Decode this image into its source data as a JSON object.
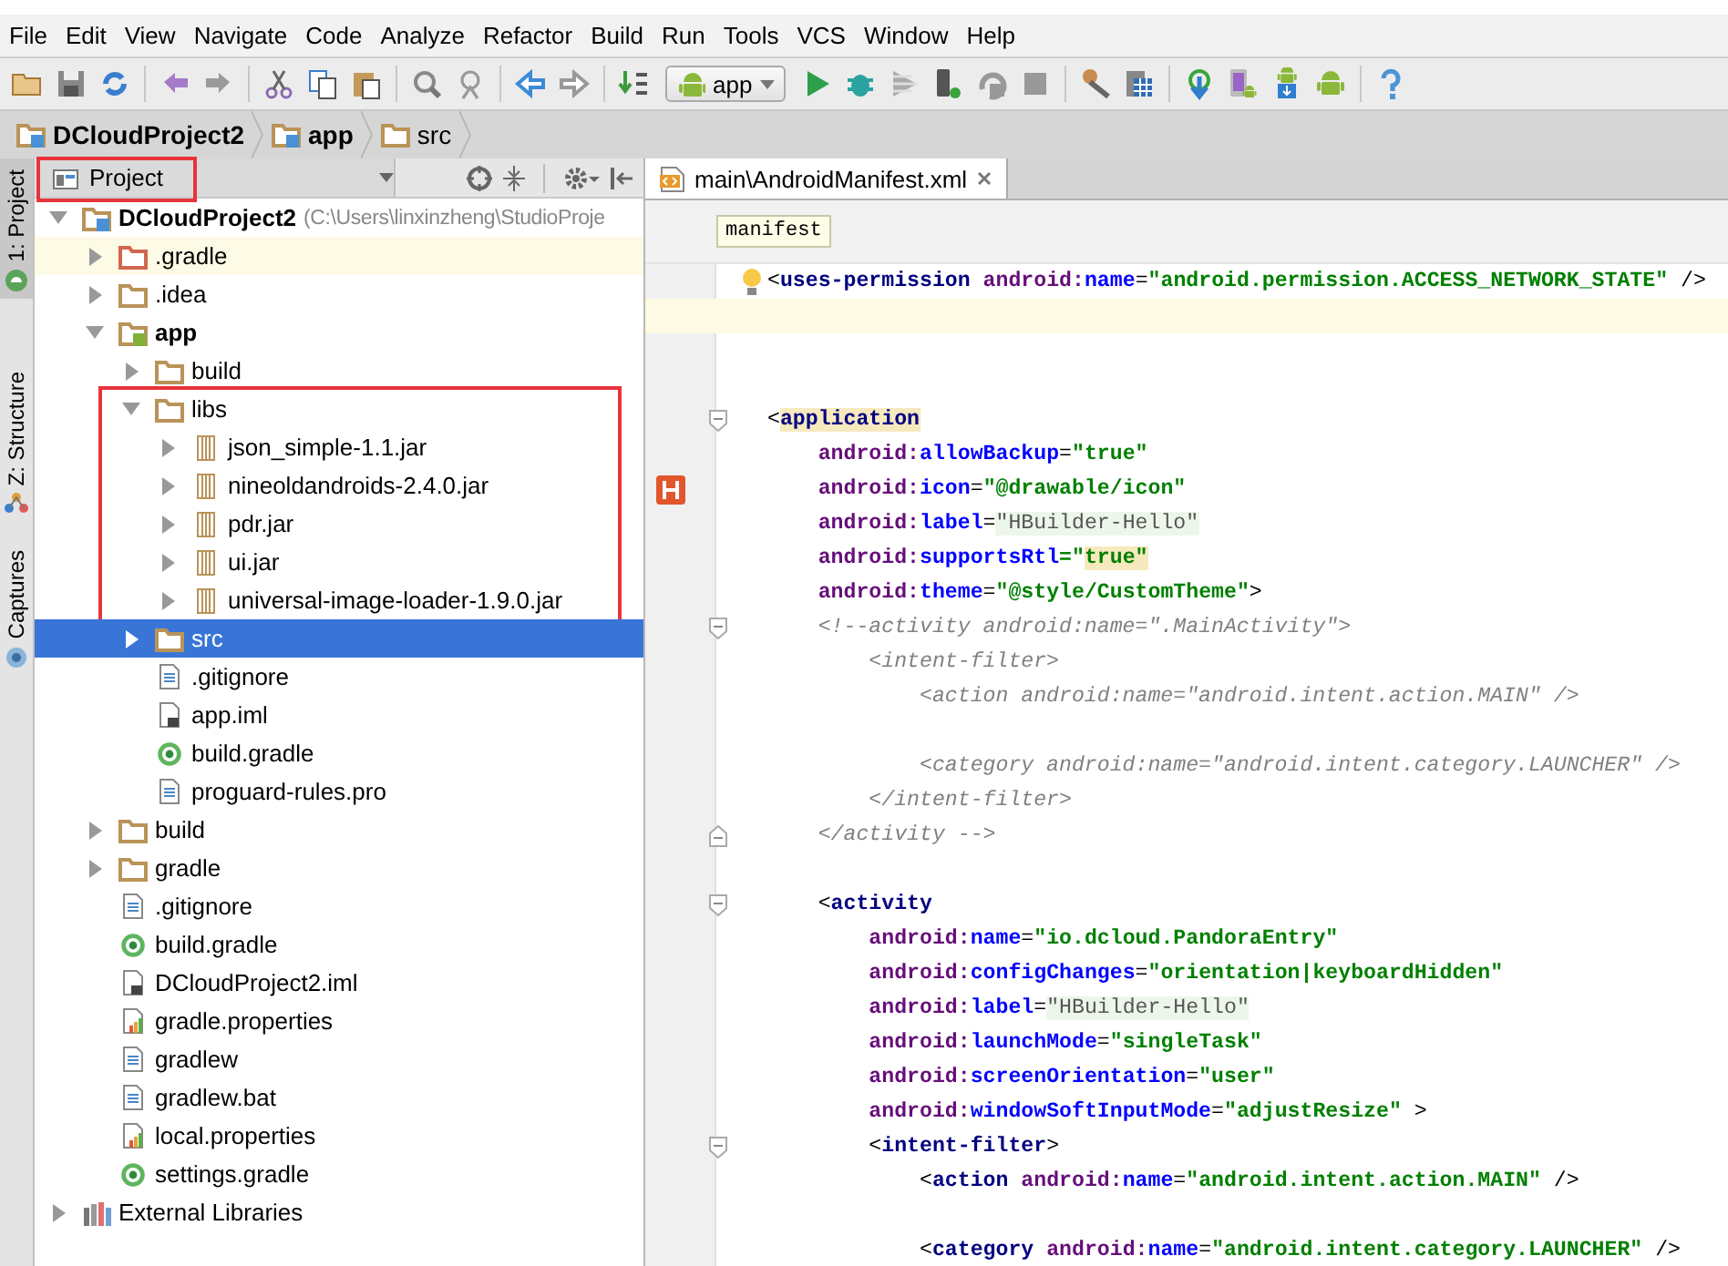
{
  "menu": [
    "File",
    "Edit",
    "View",
    "Navigate",
    "Code",
    "Analyze",
    "Refactor",
    "Build",
    "Run",
    "Tools",
    "VCS",
    "Window",
    "Help"
  ],
  "toolbar": {
    "run_config": "app"
  },
  "breadcrumb": [
    {
      "label": "DCloudProject2",
      "kind": "module"
    },
    {
      "label": "app",
      "kind": "module"
    },
    {
      "label": "src",
      "kind": "folder"
    }
  ],
  "side_tabs": [
    {
      "label": "1: Project",
      "kind": "project",
      "selected": true
    },
    {
      "label": "Z: Structure",
      "kind": "structure",
      "selected": false
    },
    {
      "label": "Captures",
      "kind": "captures",
      "selected": false
    }
  ],
  "project_panel": {
    "view": "Project",
    "outlined": true,
    "tree": [
      {
        "label": "DCloudProject2",
        "note": "(C:\\Users\\linxinzheng\\StudioProje",
        "kind": "project",
        "expanded": true,
        "selected": false,
        "children": [
          {
            "label": ".gradle",
            "kind": "excluded-folder",
            "expanded": false,
            "selected": false
          },
          {
            "label": ".idea",
            "kind": "folder",
            "expanded": false,
            "selected": false
          },
          {
            "label": "app",
            "kind": "app-module",
            "expanded": true,
            "selected": false,
            "children": [
              {
                "label": "build",
                "kind": "folder",
                "expanded": false,
                "selected": false
              },
              {
                "label": "libs",
                "kind": "folder",
                "expanded": true,
                "selected": false,
                "outlined": true,
                "children": [
                  {
                    "label": "json_simple-1.1.jar",
                    "kind": "jar",
                    "expanded": false,
                    "selected": false
                  },
                  {
                    "label": "nineoldandroids-2.4.0.jar",
                    "kind": "jar",
                    "expanded": false,
                    "selected": false
                  },
                  {
                    "label": "pdr.jar",
                    "kind": "jar",
                    "expanded": false,
                    "selected": false
                  },
                  {
                    "label": "ui.jar",
                    "kind": "jar",
                    "expanded": false,
                    "selected": false
                  },
                  {
                    "label": "universal-image-loader-1.9.0.jar",
                    "kind": "jar",
                    "expanded": false,
                    "selected": false
                  }
                ]
              },
              {
                "label": "src",
                "kind": "folder",
                "expanded": false,
                "selected": true
              },
              {
                "label": ".gitignore",
                "kind": "text",
                "selected": false
              },
              {
                "label": "app.iml",
                "kind": "iml",
                "selected": false
              },
              {
                "label": "build.gradle",
                "kind": "gradle",
                "selected": false
              },
              {
                "label": "proguard-rules.pro",
                "kind": "text",
                "selected": false
              }
            ]
          },
          {
            "label": "build",
            "kind": "folder",
            "expanded": false,
            "selected": false
          },
          {
            "label": "gradle",
            "kind": "folder",
            "expanded": false,
            "selected": false
          },
          {
            "label": ".gitignore",
            "kind": "text",
            "selected": false
          },
          {
            "label": "build.gradle",
            "kind": "gradle",
            "selected": false
          },
          {
            "label": "DCloudProject2.iml",
            "kind": "iml",
            "selected": false
          },
          {
            "label": "gradle.properties",
            "kind": "properties",
            "selected": false
          },
          {
            "label": "gradlew",
            "kind": "text",
            "selected": false
          },
          {
            "label": "gradlew.bat",
            "kind": "text",
            "selected": false
          },
          {
            "label": "local.properties",
            "kind": "properties",
            "selected": false
          },
          {
            "label": "settings.gradle",
            "kind": "gradle",
            "selected": false
          }
        ]
      },
      {
        "label": "External Libraries",
        "kind": "libraries",
        "expanded": false,
        "selected": false
      }
    ]
  },
  "editor": {
    "tabs": [
      {
        "label": "main\\AndroidManifest.xml",
        "selected": true
      }
    ],
    "tag_path": [
      "manifest"
    ],
    "lines": [
      {
        "bulb": true,
        "tokens": [
          {
            "text": "<",
            "kind": "punct"
          },
          {
            "text": "uses-permission",
            "kind": "tag"
          },
          {
            "text": " android:",
            "kind": "ns"
          },
          {
            "text": "name",
            "kind": "attr"
          },
          {
            "text": "=",
            "kind": "punct"
          },
          {
            "text": "\"android.permission.ACCESS_NETWORK_STATE\"",
            "kind": "value"
          },
          {
            "text": " />",
            "kind": "punct"
          }
        ]
      },
      {
        "current": true,
        "space_after": true
      },
      {
        "space_before": true,
        "fold_start": true,
        "tokens": [
          {
            "text": "<",
            "kind": "punct"
          },
          {
            "text": "application",
            "kind": "tag",
            "matched": true
          }
        ]
      },
      {
        "tokens": [
          {
            "text": "    android:",
            "kind": "ns"
          },
          {
            "text": "allowBackup",
            "kind": "attr"
          },
          {
            "text": "=",
            "kind": "punct"
          },
          {
            "text": "\"true\"",
            "kind": "value"
          }
        ]
      },
      {
        "logo": true,
        "tokens": [
          {
            "text": "    android:",
            "kind": "ns"
          },
          {
            "text": "icon",
            "kind": "attr"
          },
          {
            "text": "=",
            "kind": "punct"
          },
          {
            "text": "\"@drawable/icon\"",
            "kind": "value"
          }
        ]
      },
      {
        "tokens": [
          {
            "text": "    android:",
            "kind": "ns"
          },
          {
            "text": "label",
            "kind": "attr"
          },
          {
            "text": "=",
            "kind": "punct"
          },
          {
            "text": "\"HBuilder-Hello\"",
            "kind": "folded",
            "injected": true
          }
        ]
      },
      {
        "tokens": [
          {
            "text": "    android:",
            "kind": "ns"
          },
          {
            "text": "supportsRtl",
            "kind": "attr"
          },
          {
            "text": "=\"",
            "kind": "value"
          },
          {
            "text": "true\"",
            "kind": "value",
            "matched": true
          }
        ]
      },
      {
        "tokens": [
          {
            "text": "    android:",
            "kind": "ns"
          },
          {
            "text": "theme",
            "kind": "attr"
          },
          {
            "text": "=",
            "kind": "punct"
          },
          {
            "text": "\"@style/CustomTheme\"",
            "kind": "value"
          },
          {
            "text": ">",
            "kind": "punct"
          }
        ]
      },
      {
        "fold_start": true,
        "tokens": [
          {
            "text": "    <!--activity android:name=\".MainActivity\">",
            "kind": "comment"
          }
        ]
      },
      {
        "tokens": [
          {
            "text": "        <intent-filter>",
            "kind": "comment"
          }
        ]
      },
      {
        "space_after": true,
        "tokens": [
          {
            "text": "            <action android:name=\"android.intent.action.MAIN\" />",
            "kind": "comment"
          }
        ]
      },
      {
        "tokens": [
          {
            "text": "            <category android:name=\"android.intent.category.LAUNCHER\" />",
            "kind": "comment"
          }
        ]
      },
      {
        "tokens": [
          {
            "text": "        </intent-filter>",
            "kind": "comment"
          }
        ]
      },
      {
        "fold_end": true,
        "space_after": true,
        "tokens": [
          {
            "text": "    </activity -->",
            "kind": "comment"
          }
        ]
      },
      {
        "fold_start": true,
        "tokens": [
          {
            "text": "    <",
            "kind": "punct"
          },
          {
            "text": "activity",
            "kind": "tag"
          }
        ]
      },
      {
        "tokens": [
          {
            "text": "        android:",
            "kind": "ns"
          },
          {
            "text": "name",
            "kind": "attr"
          },
          {
            "text": "=",
            "kind": "punct"
          },
          {
            "text": "\"io.dcloud.PandoraEntry\"",
            "kind": "value"
          }
        ]
      },
      {
        "tokens": [
          {
            "text": "        android:",
            "kind": "ns"
          },
          {
            "text": "configChanges",
            "kind": "attr"
          },
          {
            "text": "=",
            "kind": "punct"
          },
          {
            "text": "\"orientation|keyboardHidden\"",
            "kind": "value"
          }
        ]
      },
      {
        "tokens": [
          {
            "text": "        android:",
            "kind": "ns"
          },
          {
            "text": "label",
            "kind": "attr"
          },
          {
            "text": "=",
            "kind": "punct"
          },
          {
            "text": "\"HBuilder-Hello\"",
            "kind": "folded",
            "injected": true
          }
        ]
      },
      {
        "tokens": [
          {
            "text": "        android:",
            "kind": "ns"
          },
          {
            "text": "launchMode",
            "kind": "attr"
          },
          {
            "text": "=",
            "kind": "punct"
          },
          {
            "text": "\"singleTask\"",
            "kind": "value"
          }
        ]
      },
      {
        "tokens": [
          {
            "text": "        android:",
            "kind": "ns"
          },
          {
            "text": "screenOrientation",
            "kind": "attr"
          },
          {
            "text": "=",
            "kind": "punct"
          },
          {
            "text": "\"user\"",
            "kind": "value"
          }
        ]
      },
      {
        "tokens": [
          {
            "text": "        android:",
            "kind": "ns"
          },
          {
            "text": "windowSoftInputMode",
            "kind": "attr"
          },
          {
            "text": "=",
            "kind": "punct"
          },
          {
            "text": "\"adjustResize\"",
            "kind": "value"
          },
          {
            "text": " >",
            "kind": "punct"
          }
        ]
      },
      {
        "fold_start": true,
        "tokens": [
          {
            "text": "        <",
            "kind": "punct"
          },
          {
            "text": "intent-filter",
            "kind": "tag"
          },
          {
            "text": ">",
            "kind": "punct"
          }
        ]
      },
      {
        "tokens": [
          {
            "text": "            <",
            "kind": "punct"
          },
          {
            "text": "action",
            "kind": "tag"
          },
          {
            "text": " android:",
            "kind": "ns"
          },
          {
            "text": "name",
            "kind": "attr"
          },
          {
            "text": "=",
            "kind": "punct"
          },
          {
            "text": "\"android.intent.action.MAIN\"",
            "kind": "value"
          },
          {
            "text": " />",
            "kind": "punct"
          }
        ],
        "space_after": true
      },
      {
        "tokens": [
          {
            "text": "            <",
            "kind": "punct"
          },
          {
            "text": "category",
            "kind": "tag"
          },
          {
            "text": " android:",
            "kind": "ns"
          },
          {
            "text": "name",
            "kind": "attr"
          },
          {
            "text": "=",
            "kind": "punct"
          },
          {
            "text": "\"android.intent.category.LAUNCHER\"",
            "kind": "value"
          },
          {
            "text": " />",
            "kind": "punct"
          }
        ]
      }
    ]
  }
}
